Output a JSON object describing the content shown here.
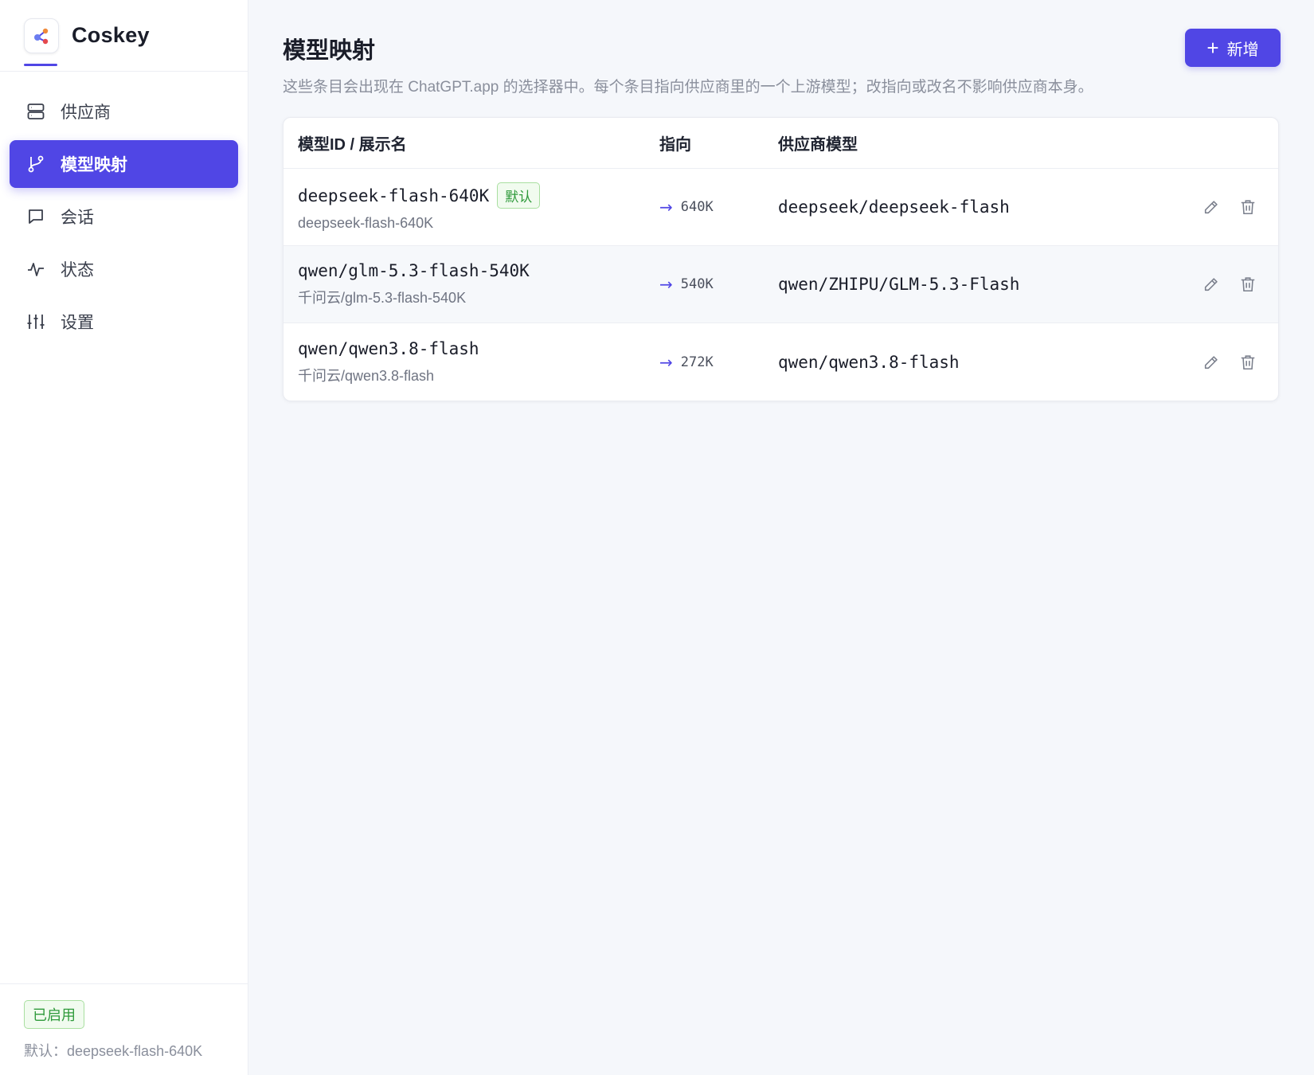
{
  "app": {
    "name": "Coskey"
  },
  "colors": {
    "accent": "#5046e5",
    "success": "#2f9a3b",
    "muted": "#8a8f9c"
  },
  "sidebar": {
    "items": [
      {
        "label": "供应商",
        "icon": "server-icon",
        "active": false
      },
      {
        "label": "模型映射",
        "icon": "branch-icon",
        "active": true
      },
      {
        "label": "会话",
        "icon": "chat-icon",
        "active": false
      },
      {
        "label": "状态",
        "icon": "activity-icon",
        "active": false
      },
      {
        "label": "设置",
        "icon": "sliders-icon",
        "active": false
      }
    ],
    "footer": {
      "status": "已启用",
      "default_text": "默认：deepseek-flash-640K"
    }
  },
  "main": {
    "title": "模型映射",
    "description": "这些条目会出现在 ChatGPT.app 的选择器中。每个条目指向供应商里的一个上游模型；改指向或改名不影响供应商本身。",
    "add_button": "新增",
    "table": {
      "headers": {
        "id": "模型ID / 展示名",
        "target": "指向",
        "model": "供应商模型"
      },
      "rows": [
        {
          "id": "deepseek-flash-640K",
          "display": "deepseek-flash-640K",
          "badge": "默认",
          "target": "640K",
          "model": "deepseek/deepseek-flash"
        },
        {
          "id": "qwen/glm-5.3-flash-540K",
          "display": "千问云/glm-5.3-flash-540K",
          "badge": "",
          "target": "540K",
          "model": "qwen/ZHIPU/GLM-5.3-Flash"
        },
        {
          "id": "qwen/qwen3.8-flash",
          "display": "千问云/qwen3.8-flash",
          "badge": "",
          "target": "272K",
          "model": "qwen/qwen3.8-flash"
        }
      ]
    }
  }
}
